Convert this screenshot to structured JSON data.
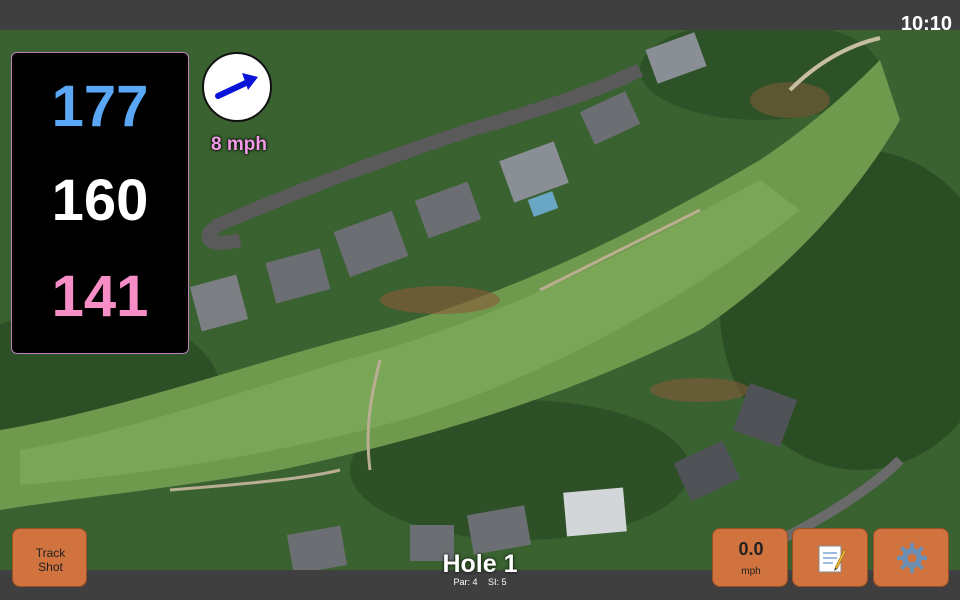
{
  "status": {
    "clock": "10:10"
  },
  "distances": {
    "back": "177",
    "center": "160",
    "front": "141"
  },
  "wind": {
    "speed": "8 mph",
    "direction_icon": "wind-arrow-icon"
  },
  "hole": {
    "title": "Hole 1",
    "par": "Par: 4",
    "stroke_index": "SI: 5"
  },
  "buttons": {
    "track_shot_line1": "Track",
    "track_shot_line2": "Shot",
    "speed_value": "0.0",
    "speed_unit": "mph",
    "notes_icon": "notepad-icon",
    "settings_icon": "gear-icon"
  },
  "colors": {
    "back_distance": "#5aa7f5",
    "center_distance": "#ffffff",
    "front_distance": "#f78dc6",
    "wind_speed": "#f29ae8",
    "button_orange": "#d1733e"
  }
}
